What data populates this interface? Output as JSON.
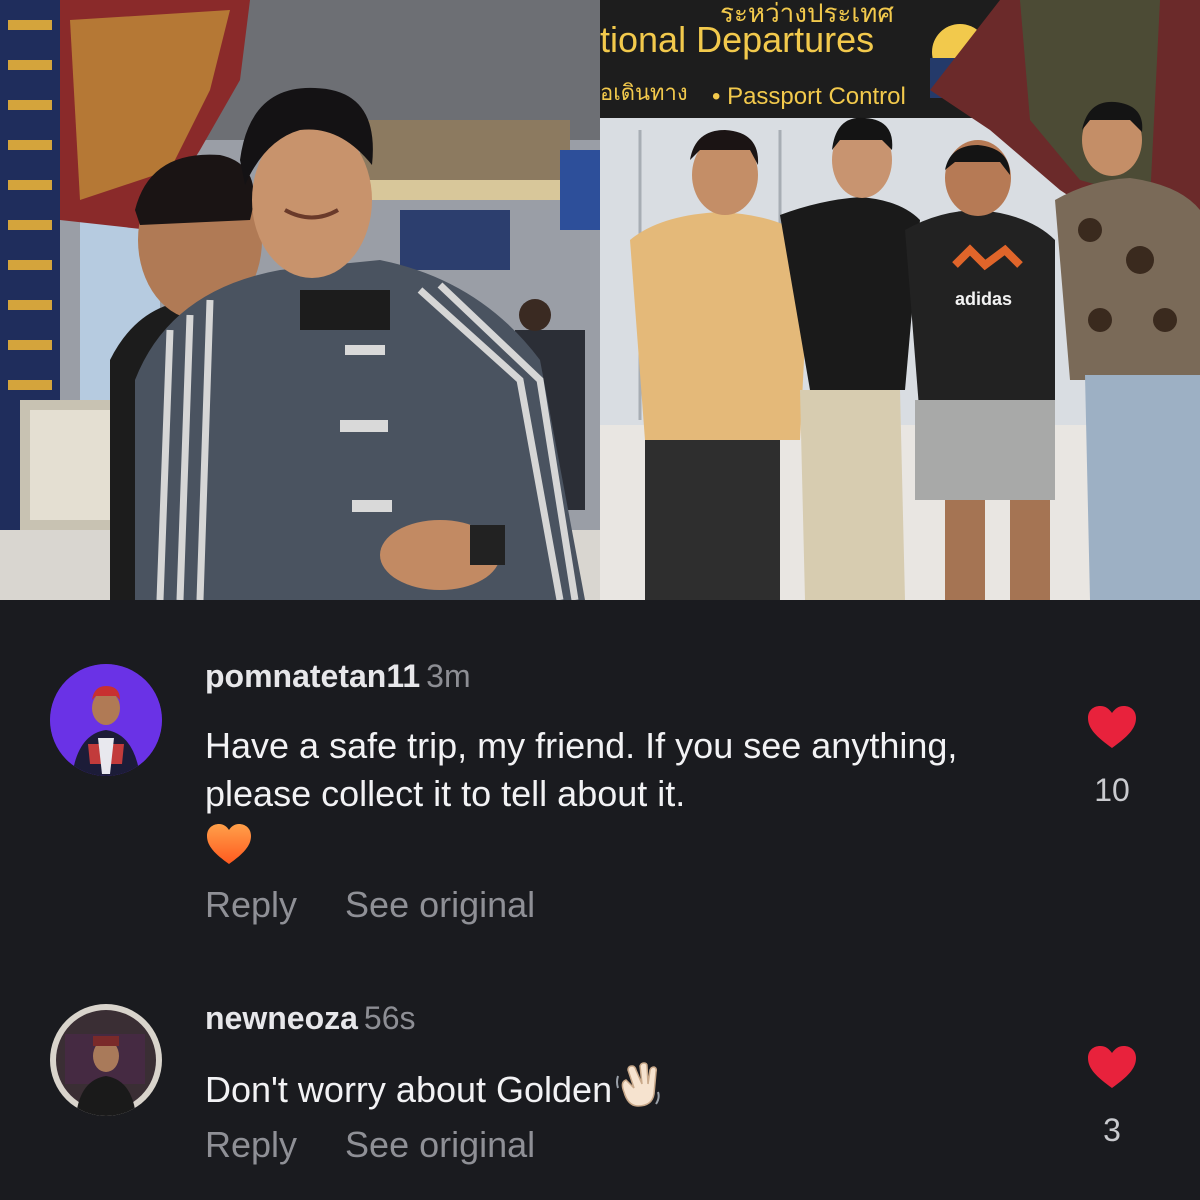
{
  "photos": {
    "left": {
      "content": "photo-left"
    },
    "right": {
      "sign_line1": "tional  Departures",
      "sign_line2_thai": "อเดินทาง",
      "sign_line2": "• Passport Control",
      "sign_top_thai": "ระหว่างประเทศ",
      "shirt_logo": "adidas"
    }
  },
  "comments": [
    {
      "username": "pomnatetan11",
      "time": "3m",
      "text": "Have a safe trip, my friend. If you see anything, please collect it to tell about it.",
      "emoji": "orange-heart-icon",
      "reply_label": "Reply",
      "see_original_label": "See original",
      "likes": "10"
    },
    {
      "username": "newneoza",
      "time": "56s",
      "text": "Don't worry about Golden",
      "emoji": "waving-hand-icon",
      "reply_label": "Reply",
      "see_original_label": "See original",
      "likes": "3"
    }
  ],
  "colors": {
    "background": "#1a1b1f",
    "like_red": "#e8223c",
    "emoji_orange": "#ff7a2a"
  }
}
